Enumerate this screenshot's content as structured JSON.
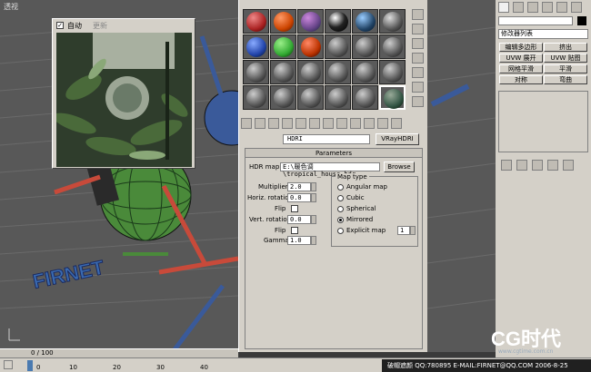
{
  "viewport": {
    "label": "透视"
  },
  "hdri_window": {
    "autofit_label": "自动",
    "refresh_label": "更新",
    "autofit_checked": true
  },
  "timeline": {
    "frame": "0 / 100"
  },
  "ruler": {
    "ticks": [
      "0",
      "10",
      "20",
      "30",
      "40"
    ]
  },
  "material_editor": {
    "material_name": "HDRI",
    "material_type": "VRayHDRI",
    "rollout_title": "Parameters",
    "hdr_map_label": "HDR map:",
    "hdr_map_path": "E:\\暖色调\\tropical_house.hdr",
    "browse_label": "Browse",
    "multiplier_label": "Multiplier:",
    "multiplier_value": "2.0",
    "horiz_label": "Horiz. rotation:",
    "horiz_value": "0.0",
    "flip_label": "Flip",
    "vert_label": "Vert. rotation:",
    "vert_value": "0.0",
    "flip2_label": "Flip",
    "gamma_label": "Gamma:",
    "gamma_value": "1.0",
    "maptype_label": "Map type",
    "map_types": [
      "Angular map",
      "Cubic",
      "Spherical",
      "Mirrored",
      "Explicit map"
    ],
    "selected_map_type": "Mirrored",
    "explicit_channel": "1"
  },
  "command_panel": {
    "modifier_list": "修改器列表",
    "buttons": [
      "编辑多边形",
      "挤出",
      "UVW 展开",
      "UVW 贴图",
      "网格平滑",
      "平滑",
      "对称",
      "弯曲"
    ]
  },
  "status": {
    "text": "破帽遮颜  QQ:780895  E-MAIL:FIRNET@QQ.COM  2006-8-25"
  },
  "watermark": {
    "logo": "CG时代",
    "url": "www.cgtime.com.cn"
  },
  "colors": {
    "viewport_bg": "#585858",
    "panel_bg": "#d4d0c8",
    "accent_green": "#4a8a3a",
    "accent_blue": "#3a5a9a"
  }
}
